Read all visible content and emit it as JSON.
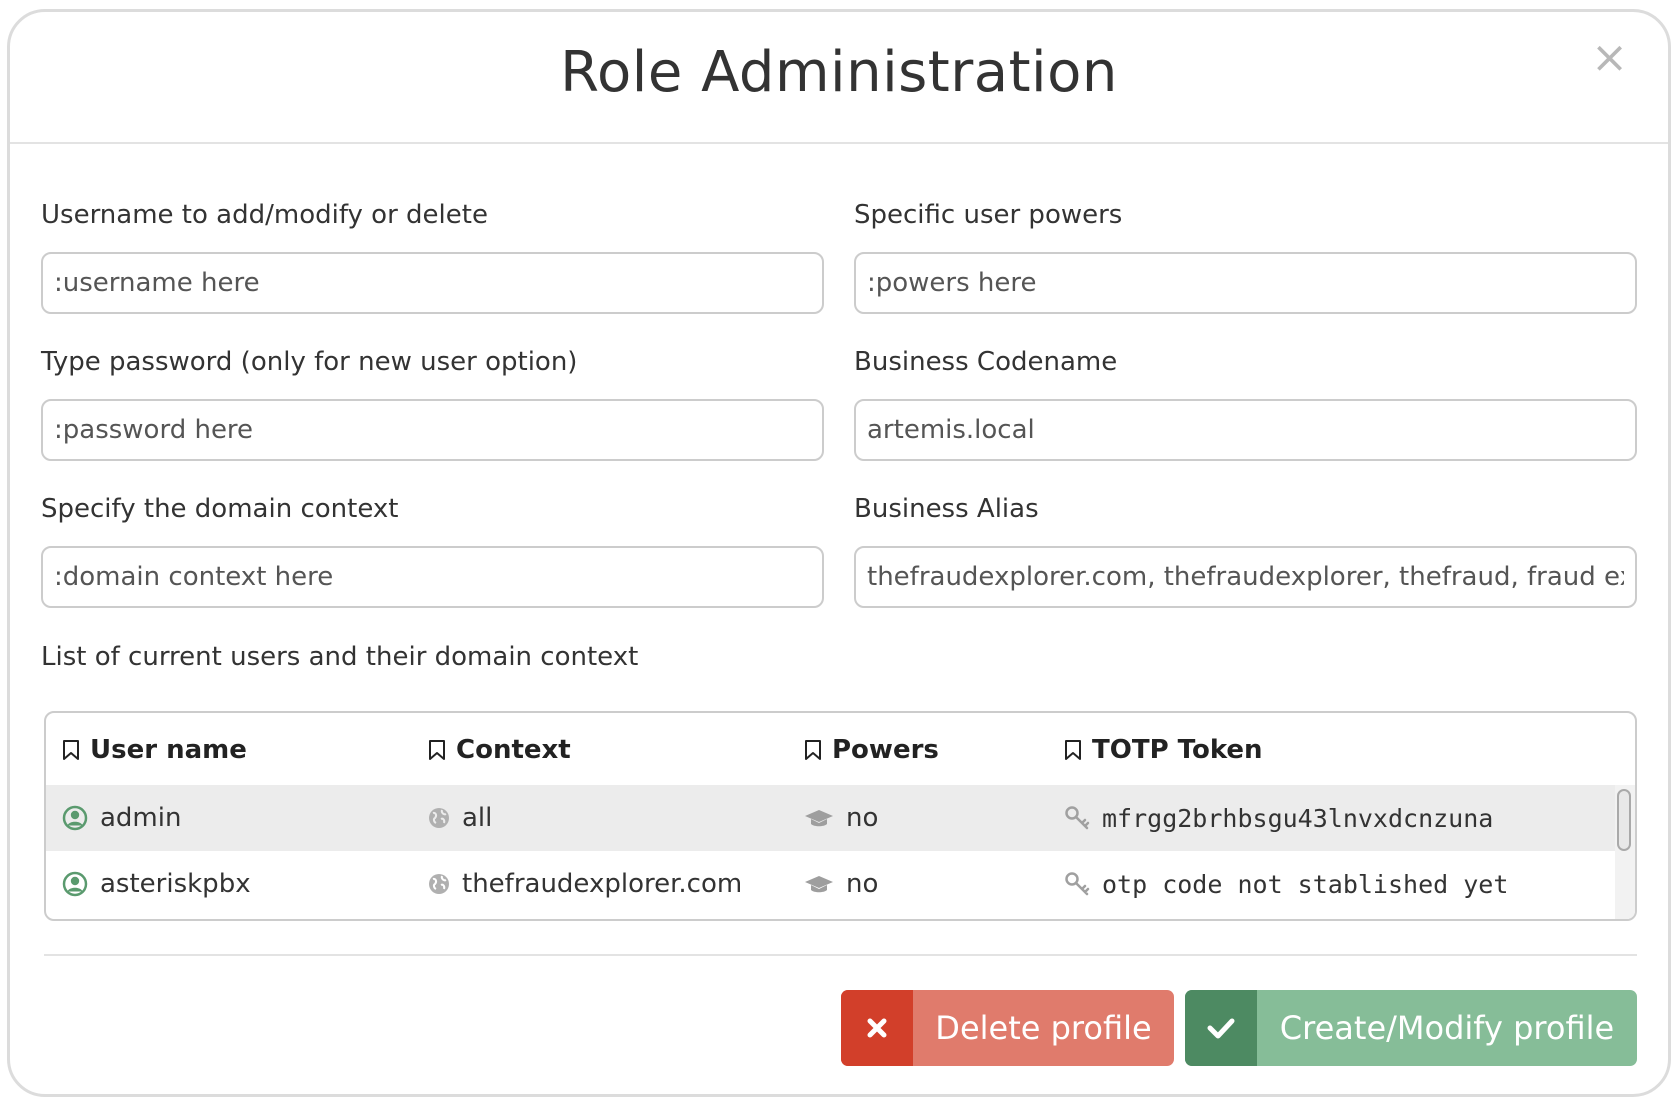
{
  "dialog": {
    "title": "Role Administration",
    "close_glyph": "×"
  },
  "form": {
    "username": {
      "label": "Username to add/modify or delete",
      "placeholder": ":username here",
      "value": ""
    },
    "powers": {
      "label": "Specific user powers",
      "placeholder": ":powers here",
      "value": ""
    },
    "password": {
      "label": "Type password (only for new user option)",
      "placeholder": ":password here",
      "value": ""
    },
    "business_codename": {
      "label": "Business Codename",
      "placeholder": "",
      "value": "artemis.local"
    },
    "domain_context": {
      "label": "Specify the domain context",
      "placeholder": ":domain context here",
      "value": ""
    },
    "business_alias": {
      "label": "Business Alias",
      "placeholder": "",
      "value": "thefraudexplorer.com, thefraudexplorer, thefraud, fraud exp"
    }
  },
  "users_table": {
    "caption": "List of current users and their domain context",
    "columns": [
      "User name",
      "Context",
      "Powers",
      "TOTP Token"
    ],
    "rows": [
      {
        "user": "admin",
        "context": "all",
        "powers": "no",
        "totp": "mfrgg2brhbsgu43lnvxdcnzuna"
      },
      {
        "user": "asteriskpbx",
        "context": "thefraudexplorer.com",
        "powers": "no",
        "totp": "otp code not stablished yet"
      }
    ]
  },
  "actions": {
    "delete_label": "Delete profile",
    "create_label": "Create/Modify profile"
  },
  "colors": {
    "delete_light": "#e07b6c",
    "delete_dark": "#d23f2a",
    "create_light": "#86bd98",
    "create_dark": "#4d8a62",
    "user_icon": "#5a9a6e"
  },
  "icons": {
    "column_header": "bookmark-icon",
    "user": "user-circle-icon",
    "context": "globe-icon",
    "powers": "graduation-cap-icon",
    "totp": "key-icon",
    "delete": "times-icon",
    "create": "check-icon",
    "close": "close-icon"
  }
}
